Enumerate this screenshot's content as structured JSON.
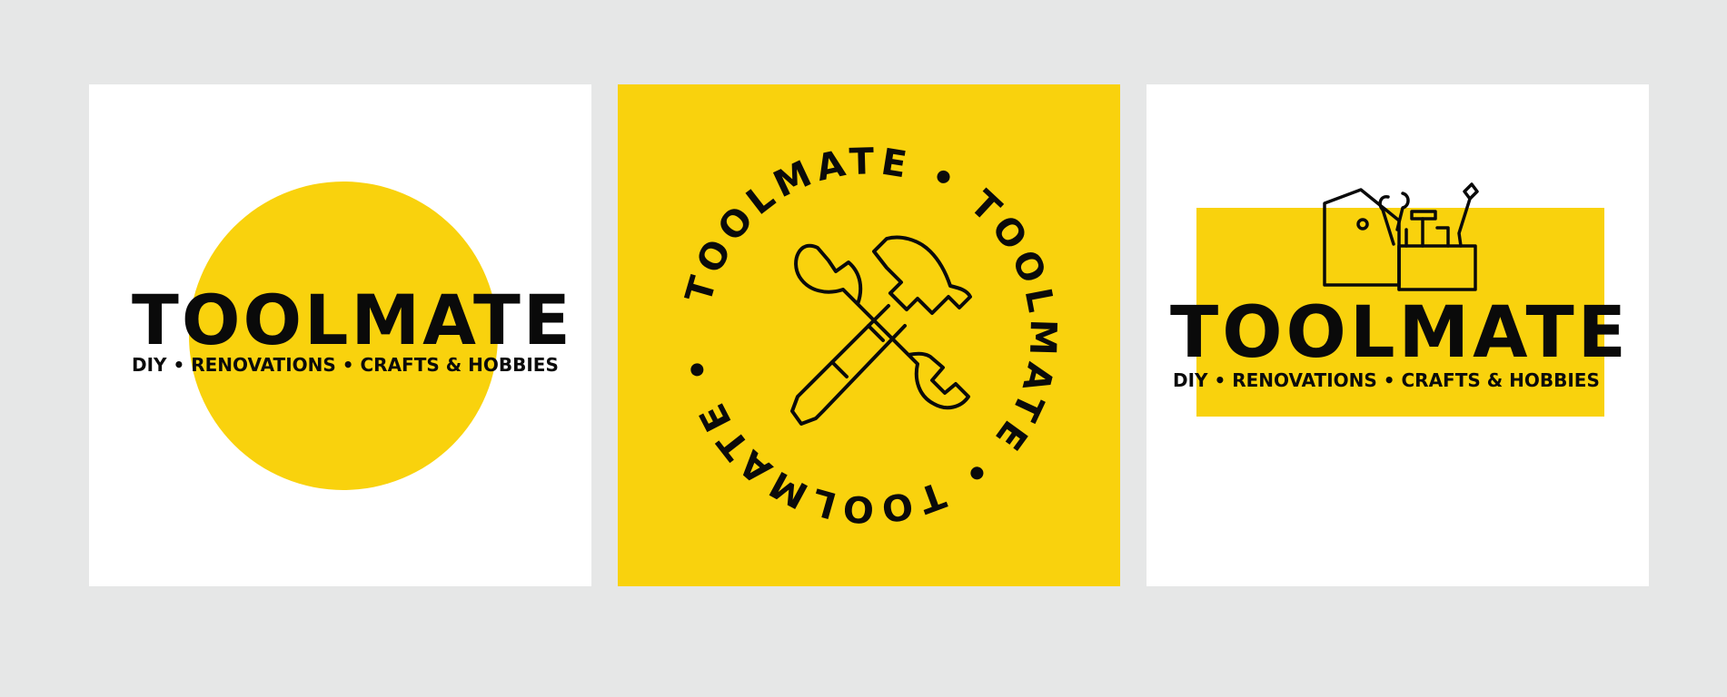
{
  "brand": {
    "name": "TOOLMATE",
    "tagline": "DIY • RENOVATIONS • CRAFTS & HOBBIES",
    "ring_text": "TOOLMATE • TOOLMATE • TOOLMATE •"
  },
  "colors": {
    "background": "#e6e7e7",
    "accent_yellow": "#f9d20d",
    "ink": "#0a0a0a",
    "panel_white": "#ffffff"
  },
  "panels": [
    {
      "variant": "circle-badge",
      "background": "white"
    },
    {
      "variant": "round-emblem",
      "background": "yellow",
      "icon": "wrench-and-hammer-icon"
    },
    {
      "variant": "toolbox-lockup",
      "background": "white",
      "icon": "toolbox-icon"
    }
  ]
}
